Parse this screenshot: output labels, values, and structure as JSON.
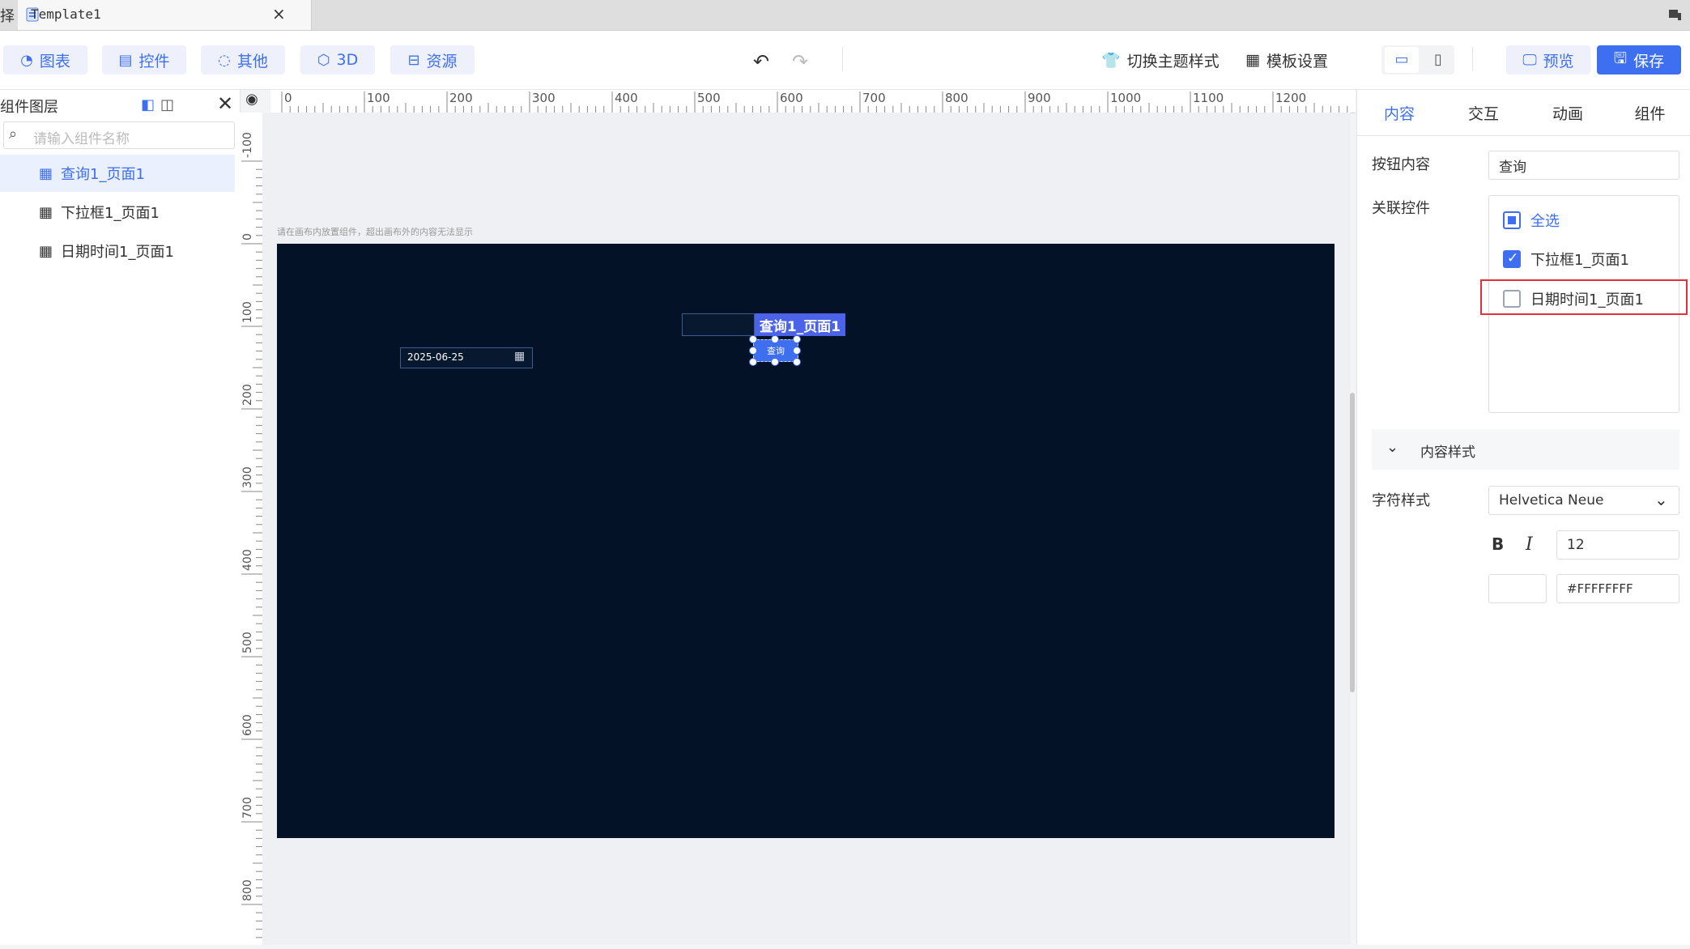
{
  "window": {
    "edge_char": "择",
    "tab_title": "Template1",
    "tab_close": "×"
  },
  "toolbar": {
    "chart": "图表",
    "widget": "控件",
    "other": "其他",
    "three_d": "3D",
    "resource": "资源",
    "switch_theme": "切换主题样式",
    "template_settings": "模板设置",
    "preview": "预览",
    "save": "保存"
  },
  "left_panel": {
    "title": "组件图层",
    "search_placeholder": "请输入组件名称",
    "layers": [
      {
        "label": "查询1_页面1",
        "active": true
      },
      {
        "label": "下拉框1_页面1",
        "active": false
      },
      {
        "label": "日期时间1_页面1",
        "active": false
      }
    ]
  },
  "ruler": {
    "top": [
      "0",
      "100",
      "200",
      "300",
      "400",
      "500",
      "600",
      "700",
      "800",
      "900",
      "1000",
      "1100",
      "1200"
    ],
    "left": [
      "-100",
      "0",
      "100",
      "200",
      "300",
      "400",
      "500",
      "600",
      "700",
      "800"
    ]
  },
  "canvas": {
    "hint": "请在画布内放置组件，超出画布外的内容无法显示",
    "date_value": "2025-06-25",
    "selected_tag": "查询1_页面1",
    "query_button": "查询"
  },
  "right_panel": {
    "tabs": [
      "内容",
      "交互",
      "动画",
      "组件"
    ],
    "button_content_label": "按钮内容",
    "button_content_value": "查询",
    "related_widgets_label": "关联控件",
    "select_all": "全选",
    "related": [
      {
        "label": "下拉框1_页面1",
        "checked": true
      },
      {
        "label": "日期时间1_页面1",
        "checked": false
      }
    ],
    "content_style": "内容样式",
    "font_style_label": "字符样式",
    "font_family_value": "Helvetica Neue",
    "bold": "B",
    "italic": "I",
    "font_size": "12",
    "color_hex": "#FFFFFFFF"
  },
  "colors": {
    "accent": "#3d6ff0",
    "canvas_bg": "#041228",
    "highlight": "#e0303a"
  }
}
